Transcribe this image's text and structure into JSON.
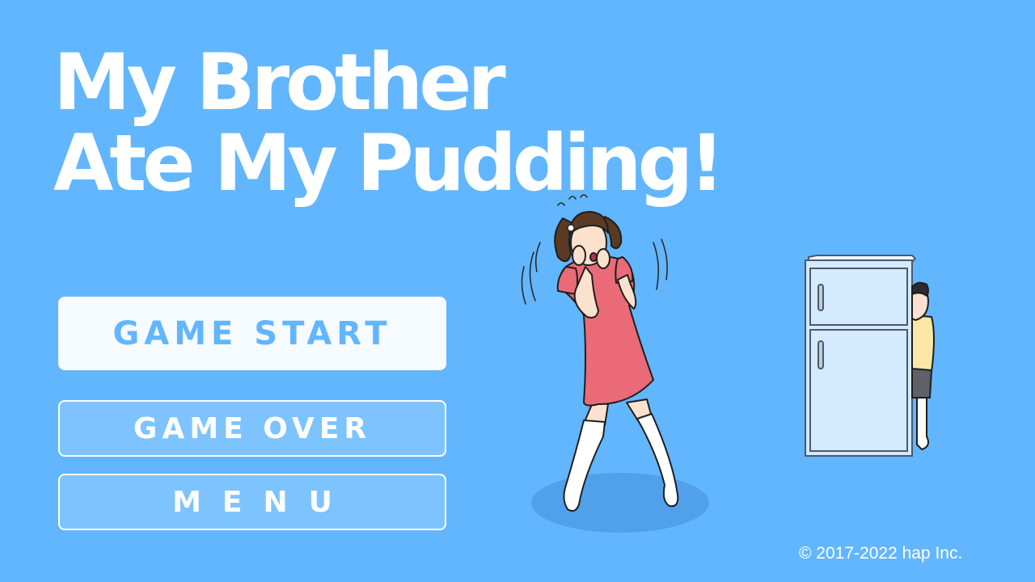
{
  "game": {
    "title_line1": "My Brother",
    "title_line2": "Ate My Pudding!"
  },
  "menu": {
    "start_label": "GAME START",
    "gameover_label": "GAME OVER",
    "menu_label": "MENU"
  },
  "footer": {
    "copyright": "© 2017-2022 hap Inc."
  },
  "colors": {
    "background": "#62b6fd",
    "start_button_bg": "#f6fbff",
    "start_button_text": "#62b6fd",
    "secondary_button_bg": "#7dc4ff",
    "girl_dress": "#eb6a78",
    "fridge": "#d4eaff"
  },
  "icons": {
    "illustration": "panicking-girl-and-hiding-brother"
  }
}
